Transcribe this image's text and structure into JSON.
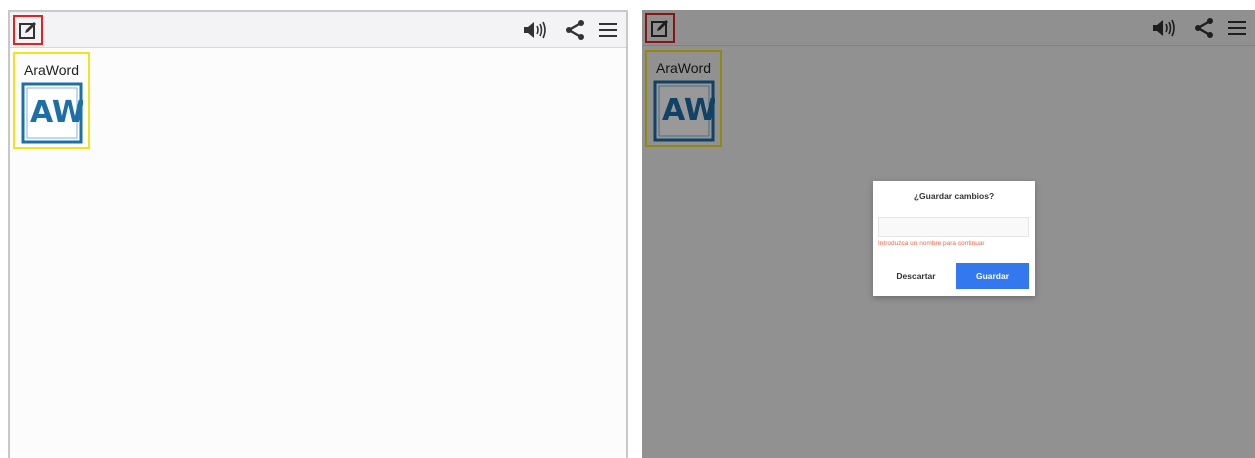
{
  "left_screen": {
    "toolbar": {
      "icons": [
        "edit-icon",
        "volume-icon",
        "share-icon",
        "menu-icon"
      ]
    },
    "tile": {
      "label": "AraWord",
      "logo_text": "AW",
      "icon": "araword-logo"
    }
  },
  "right_screen": {
    "toolbar": {
      "icons": [
        "edit-icon",
        "volume-icon",
        "share-icon",
        "menu-icon"
      ]
    },
    "tile": {
      "label": "AraWord",
      "logo_text": "AW",
      "icon": "araword-logo"
    },
    "dialog": {
      "title": "¿Guardar cambios?",
      "input_value": "",
      "error_text": "Introduzca un nombre para continuar",
      "discard_label": "Descartar",
      "save_label": "Guardar"
    }
  },
  "colors": {
    "highlight_red": "#e02424",
    "highlight_yellow": "#f0e41c",
    "logo_blue": "#1d6fa8",
    "save_button": "#3478f0",
    "error_text": "#f0664a"
  }
}
